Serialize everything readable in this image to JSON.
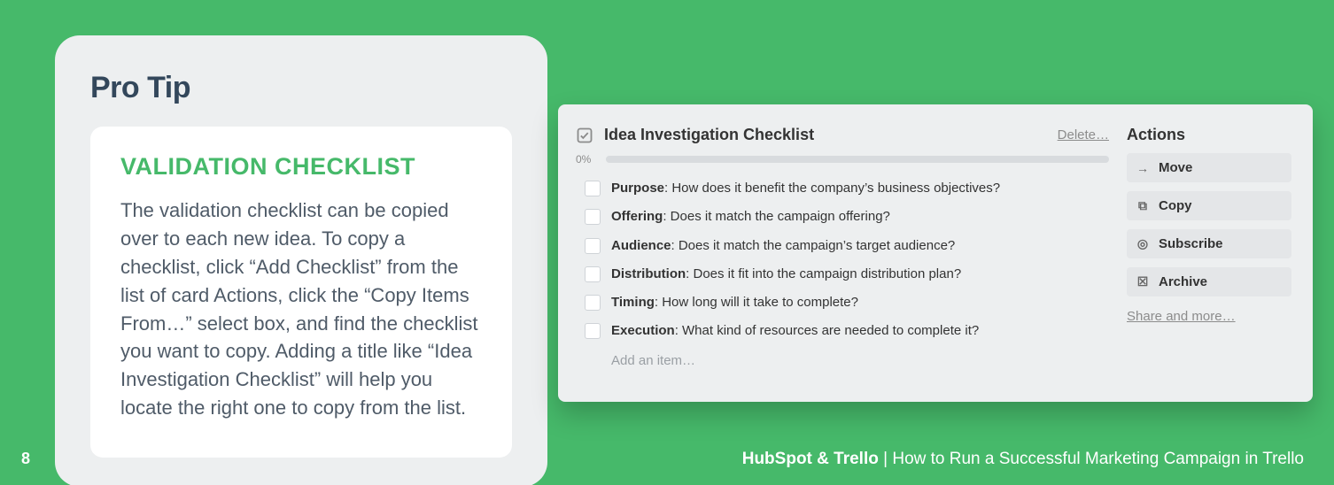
{
  "pro": {
    "heading": "Pro Tip",
    "subheading": "VALIDATION CHECKLIST",
    "body": "The validation checklist can be copied over to each new idea. To copy a checklist, click “Add Checklist” from the list of card Actions, click the “Copy Items From…” select box, and find the checklist you want to copy. Adding a title like “Idea Investigation Checklist” will help you locate the right one to copy from the list."
  },
  "checklist": {
    "title": "Idea Investigation Checklist",
    "delete": "Delete…",
    "percent": "0%",
    "add_item": "Add an item…",
    "items": [
      {
        "label": "Purpose",
        "text": ": How does it benefit the company’s business objectives?"
      },
      {
        "label": "Offering",
        "text": ": Does it match the campaign offering?"
      },
      {
        "label": "Audience",
        "text": ": Does it match the campaign’s target audience?"
      },
      {
        "label": "Distribution",
        "text": ": Does it fit into the campaign distribution plan?"
      },
      {
        "label": "Timing",
        "text": ": How long will it take to complete?"
      },
      {
        "label": "Execution",
        "text": ": What kind of resources are needed to complete it?"
      }
    ]
  },
  "actions": {
    "title": "Actions",
    "buttons": [
      {
        "icon": "→",
        "label": "Move"
      },
      {
        "icon": "⧉",
        "label": "Copy"
      },
      {
        "icon": "◎",
        "label": "Subscribe"
      },
      {
        "icon": "☒",
        "label": "Archive"
      }
    ],
    "share": "Share and more…"
  },
  "footer": {
    "page": "8",
    "brand": "HubSpot & Trello",
    "sep": " | ",
    "title": "How to Run a Successful Marketing Campaign in Trello"
  }
}
